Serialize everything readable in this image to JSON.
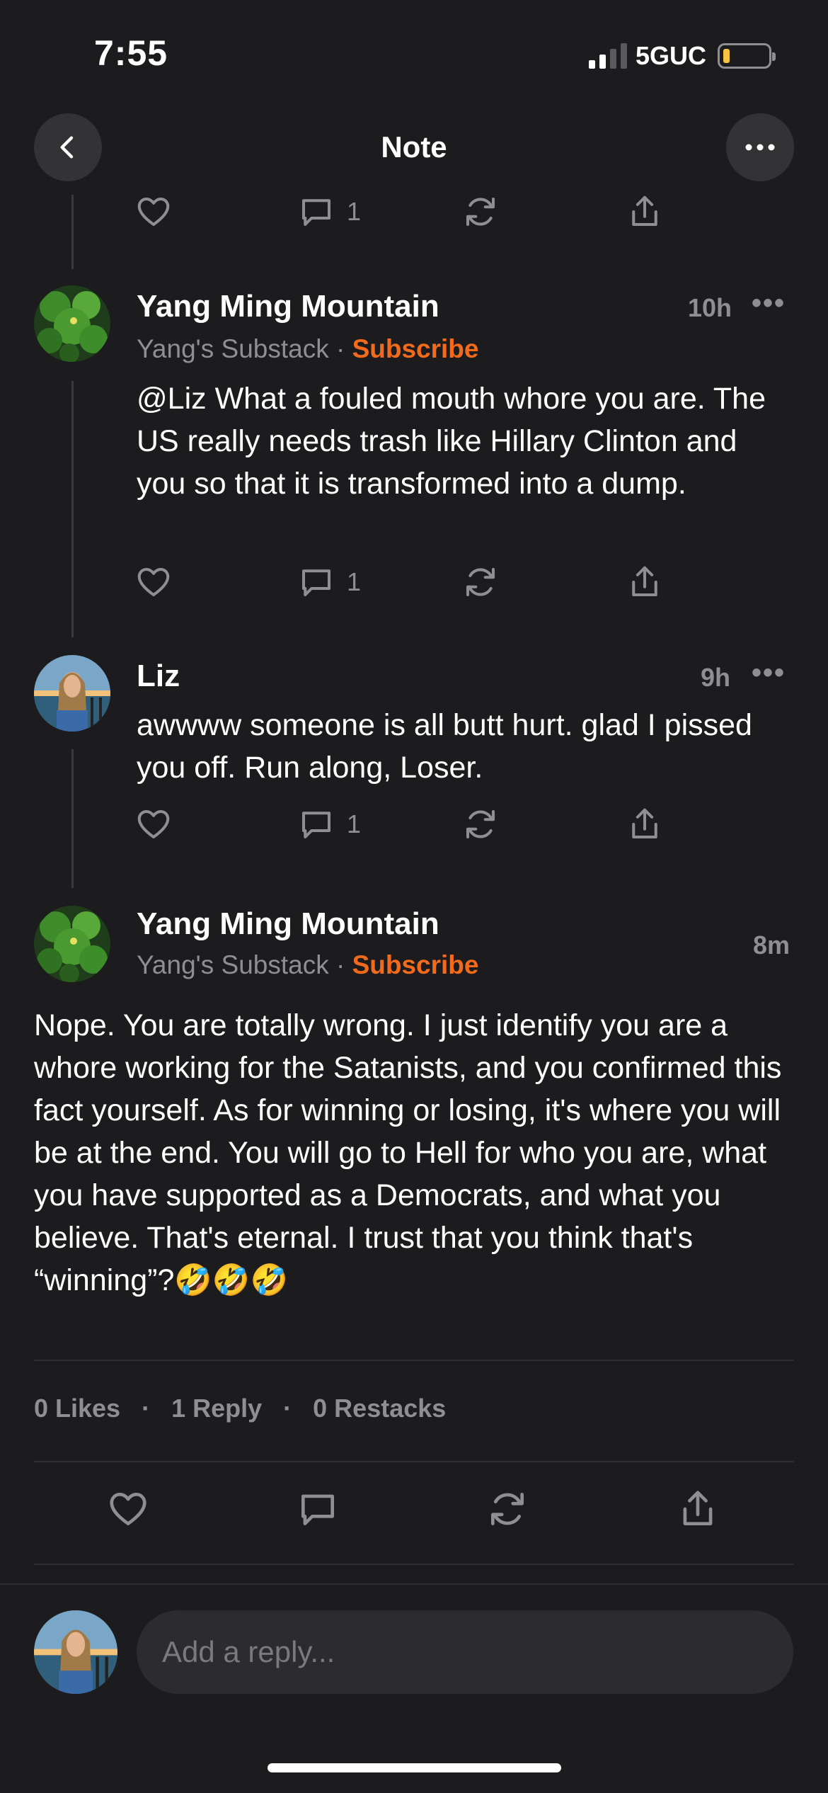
{
  "status": {
    "time": "7:55",
    "network": "5GUC"
  },
  "nav": {
    "title": "Note"
  },
  "top_actions": {
    "comment_count": "1"
  },
  "comments": [
    {
      "author": "Yang Ming Mountain",
      "publication": "Yang's Substack",
      "separator": "·",
      "subscribe": "Subscribe",
      "time": "10h",
      "text": "@Liz What a fouled mouth whore you are. The US really needs trash like Hillary Clinton and you so that it is transformed into a dump.",
      "comment_count": "1"
    },
    {
      "author": "Liz",
      "time": "9h",
      "text": "awwww someone is all butt hurt.  glad I pissed you off. Run along, Loser.",
      "comment_count": "1"
    }
  ],
  "main_note": {
    "author": "Yang Ming Mountain",
    "publication": "Yang's Substack",
    "separator": "·",
    "subscribe": "Subscribe",
    "time": "8m",
    "text": "Nope. You are totally wrong. I just identify you are a whore working for the Satanists, and you confirmed this fact yourself. As for winning or losing, it's where you will be at the end. You will go to Hell for who you are, what you have supported as a Democrats, and what you believe. That's eternal. I trust that you think that's “winning”?🤣🤣🤣"
  },
  "stats": {
    "likes": "0 Likes",
    "replies": "1 Reply",
    "restacks": "0 Restacks",
    "separator": "·"
  },
  "reply": {
    "placeholder": "Add a reply..."
  },
  "icons": [
    "back-icon",
    "more-icon",
    "heart-icon",
    "comment-icon",
    "restack-icon",
    "share-icon"
  ],
  "colors": {
    "background": "#1c1c1e",
    "accent": "#f26a1b",
    "muted": "#8e8e93"
  }
}
